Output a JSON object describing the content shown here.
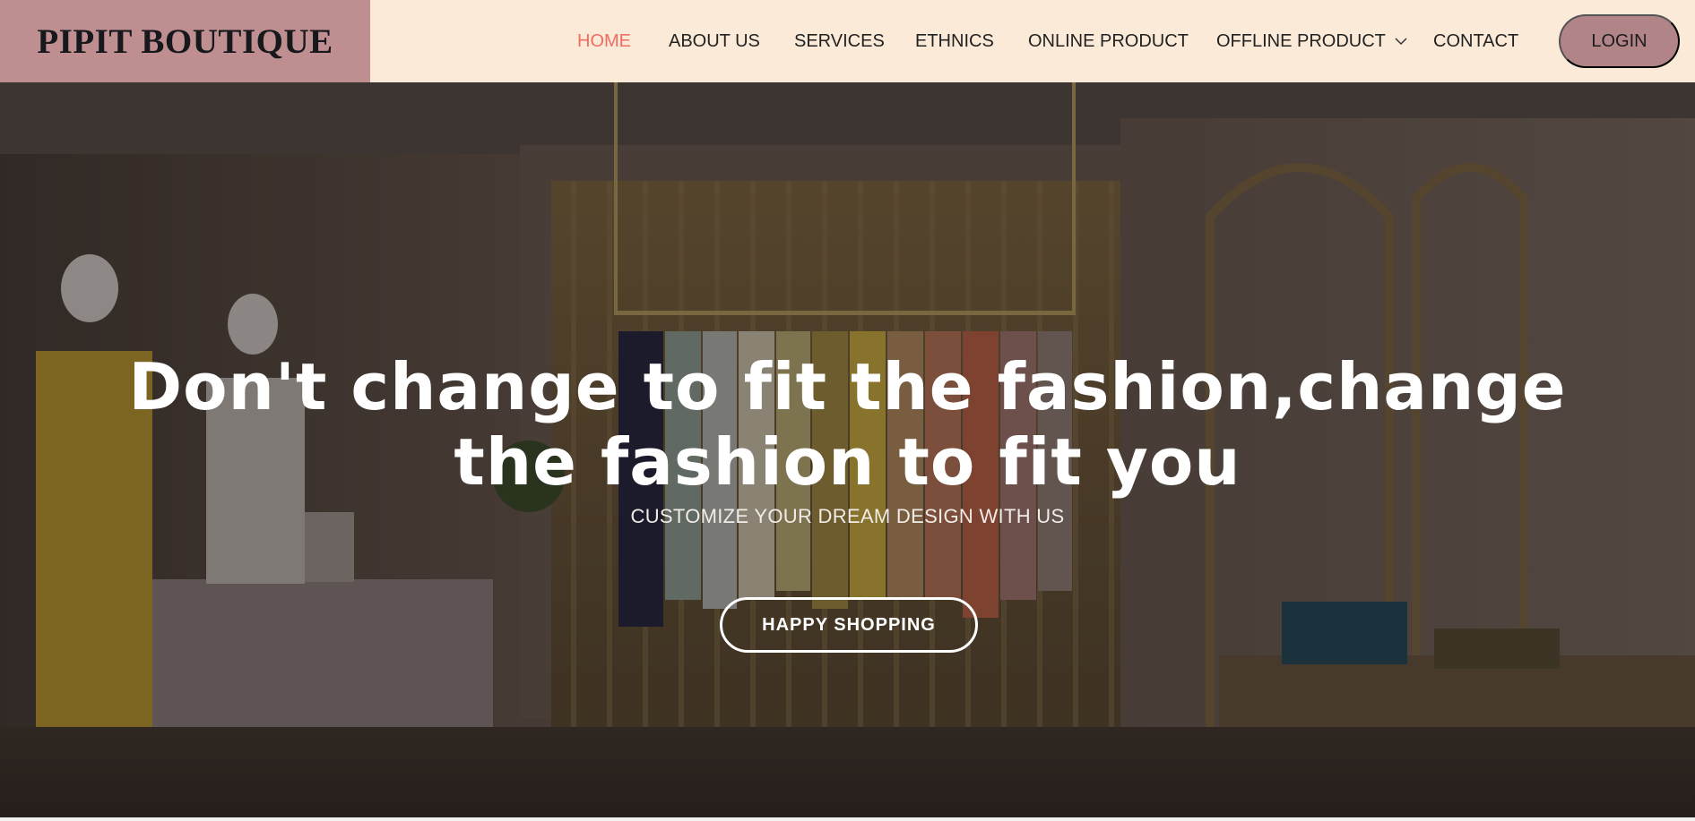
{
  "brand": {
    "name": "PIPIT BOUTIQUE"
  },
  "nav": {
    "items": [
      {
        "label": "HOME",
        "active": true
      },
      {
        "label": "ABOUT US"
      },
      {
        "label": "SERVICES"
      },
      {
        "label": "ETHNICS"
      },
      {
        "label": "ONLINE PRODUCT"
      },
      {
        "label": "OFFLINE PRODUCT",
        "icon": "chevron-down-icon"
      },
      {
        "label": "CONTACT"
      }
    ],
    "login_label": "LOGIN"
  },
  "hero": {
    "heading": "Don't change to fit the fashion,change the fashion to fit you",
    "subheading": "CUSTOMIZE YOUR DREAM DESIGN WITH US",
    "cta_label": "HAPPY SHOPPING",
    "background": "boutique-interior-photo"
  },
  "colors": {
    "nav_bg": "#fbead7",
    "brand_bg": "#bf8e91",
    "active_link": "#ef6d63",
    "login_bg": "#b18587"
  }
}
